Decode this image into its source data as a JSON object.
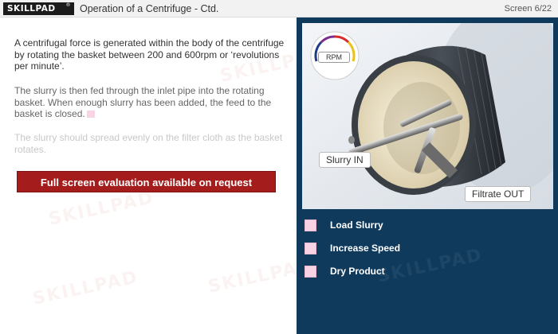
{
  "header": {
    "logo_text": "SKILLPAD",
    "logo_mark": "®",
    "title": "Operation of a Centrifuge - Ctd.",
    "screen_counter": "Screen 6/22"
  },
  "content": {
    "paragraph1": "A centrifugal force is generated within the body of the centrifuge by rotating the basket between 200 and 600rpm or ‘revolutions per minute’.",
    "paragraph2": "The slurry is then fed through the inlet pipe into the rotating basket. When enough slurry has been added, the feed to the basket is closed.",
    "paragraph3": "The slurry should spread evenly on the filter cloth as the basket rotates.",
    "evaluation_button": "Full screen evaluation available on request"
  },
  "illustration": {
    "gauge_label": "RPM",
    "slurry_in_label": "Slurry IN",
    "filtrate_out_label": "Filtrate OUT"
  },
  "options": [
    {
      "label": "Load Slurry"
    },
    {
      "label": "Increase Speed"
    },
    {
      "label": "Dry Product"
    }
  ],
  "colors": {
    "panel_bg": "#0f3a5c",
    "button_red": "#a41c1c",
    "option_pink": "#f7d3e4",
    "header_bg": "#f2f2f2"
  }
}
